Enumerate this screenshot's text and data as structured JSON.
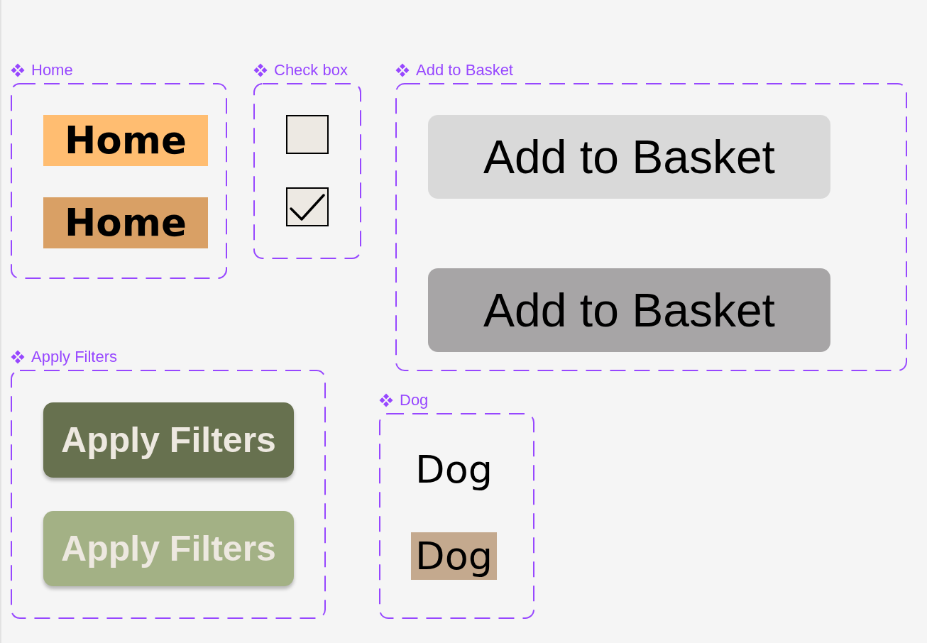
{
  "component_sets": [
    {
      "kind": "nav_button",
      "title": "Home",
      "variants": [
        {
          "label": "Home",
          "hovered": false
        },
        {
          "label": "Home",
          "hovered": true
        }
      ]
    },
    {
      "kind": "checkbox",
      "title": "Check box",
      "variants": [
        {
          "checked": false
        },
        {
          "checked": true
        }
      ]
    },
    {
      "kind": "basket_button",
      "title": "Add to Basket",
      "variants": [
        {
          "label": "Add to Basket",
          "hovered": false
        },
        {
          "label": "Add to Basket",
          "hovered": true
        }
      ]
    },
    {
      "kind": "filter_button",
      "title": "Apply Filters",
      "variants": [
        {
          "label": "Apply Filters",
          "hovered": false
        },
        {
          "label": "Apply Filters",
          "hovered": true
        }
      ]
    },
    {
      "kind": "text_chip",
      "title": "Dog",
      "variants": [
        {
          "label": "Dog",
          "hovered": false
        },
        {
          "label": "Dog",
          "hovered": true
        }
      ]
    }
  ]
}
